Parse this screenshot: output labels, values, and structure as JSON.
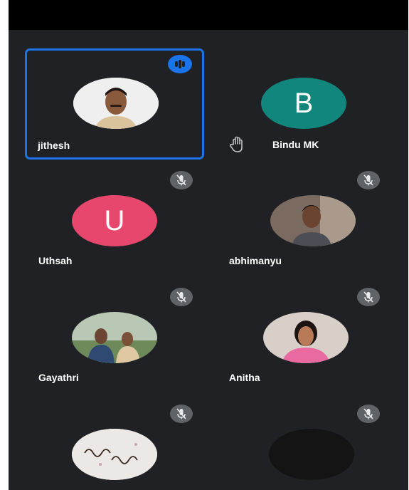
{
  "participants": [
    {
      "name": "jithesh",
      "avatar": "photo",
      "status": "speaking"
    },
    {
      "name": "Bindu MK",
      "avatar_letter": "B",
      "avatar_color": "#11867c",
      "status": "hand-raised"
    },
    {
      "name": "Uthsah",
      "avatar_letter": "U",
      "avatar_color": "#e8476d",
      "status": "muted"
    },
    {
      "name": "abhimanyu",
      "avatar": "photo",
      "status": "muted"
    },
    {
      "name": "Gayathri",
      "avatar": "photo",
      "status": "muted"
    },
    {
      "name": "Anitha",
      "avatar": "photo",
      "status": "muted"
    },
    {
      "name": "",
      "avatar": "photo",
      "status": "muted"
    },
    {
      "name": "",
      "avatar": "photo",
      "status": "muted"
    }
  ],
  "colors": {
    "background": "#202124",
    "active_speaker_border": "#1a73e8",
    "muted_badge": "#5f6368"
  },
  "icons": {
    "speaking": "speaking-indicator-icon",
    "muted": "mic-off-icon",
    "hand": "hand-raised-icon"
  }
}
